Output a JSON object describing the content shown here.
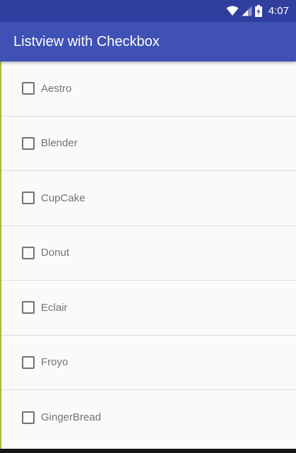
{
  "status_bar": {
    "time": "4:07",
    "background_color": "#303f9f",
    "icons": [
      "wifi-icon",
      "cell-signal-icon",
      "battery-icon"
    ]
  },
  "app_bar": {
    "title": "Listview with Checkbox",
    "background_color": "#3f51b5"
  },
  "list": {
    "items": [
      {
        "label": "Aestro",
        "checked": false
      },
      {
        "label": "Blender",
        "checked": false
      },
      {
        "label": "CupCake",
        "checked": false
      },
      {
        "label": "Donut",
        "checked": false
      },
      {
        "label": "Eclair",
        "checked": false
      },
      {
        "label": "Froyo",
        "checked": false
      },
      {
        "label": "GingerBread",
        "checked": false
      }
    ]
  }
}
